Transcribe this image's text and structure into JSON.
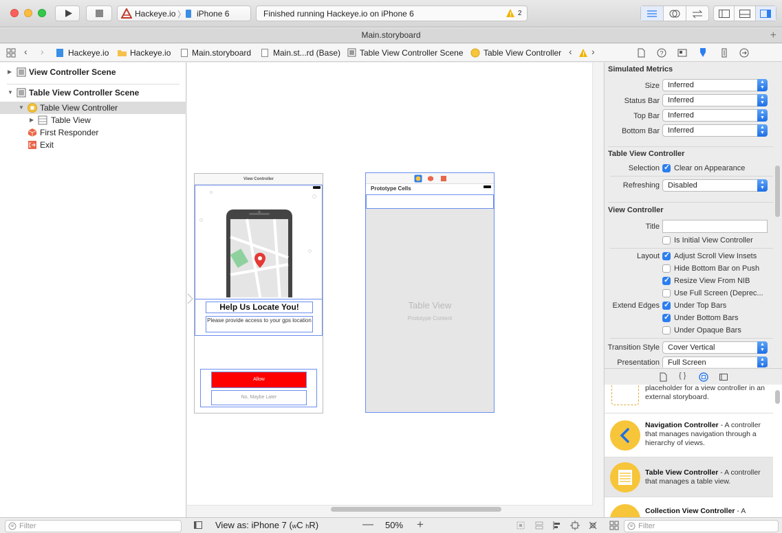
{
  "toolbar": {
    "scheme_name": "Hackeye.io",
    "device": "iPhone 6",
    "status_text": "Finished running Hackeye.io on iPhone 6",
    "warning_count": "2"
  },
  "tab": {
    "title": "Main.storyboard"
  },
  "jumpbar": {
    "items": [
      "Hackeye.io",
      "Hackeye.io",
      "Main.storyboard",
      "Main.st...rd (Base)",
      "Table View Controller Scene",
      "Table View Controller"
    ]
  },
  "outline": {
    "scene1": "View Controller Scene",
    "scene2": "Table View Controller Scene",
    "controller": "Table View Controller",
    "table_view": "Table View",
    "first_responder": "First Responder",
    "exit": "Exit",
    "filter_placeholder": "Filter"
  },
  "canvas": {
    "vc_title": "View Controller",
    "help_title": "Help Us Locate You!",
    "help_text": "Please provide access to your gps location",
    "allow_label": "Allow",
    "later_label": "No, Maybe Later",
    "prototype_cells": "Prototype Cells",
    "table_view_label": "Table View",
    "prototype_content": "Prototype Content"
  },
  "inspector": {
    "simulated_metrics": {
      "header": "Simulated Metrics",
      "size_label": "Size",
      "size_value": "Inferred",
      "status_bar_label": "Status Bar",
      "status_bar_value": "Inferred",
      "top_bar_label": "Top Bar",
      "top_bar_value": "Inferred",
      "bottom_bar_label": "Bottom Bar",
      "bottom_bar_value": "Inferred"
    },
    "table_view_controller": {
      "header": "Table View Controller",
      "selection_label": "Selection",
      "clear_on_appearance": "Clear on Appearance",
      "refreshing_label": "Refreshing",
      "refreshing_value": "Disabled"
    },
    "view_controller": {
      "header": "View Controller",
      "title_label": "Title",
      "is_initial": "Is Initial View Controller",
      "layout_label": "Layout",
      "adjust_scroll": "Adjust Scroll View Insets",
      "hide_bottom": "Hide Bottom Bar on Push",
      "resize_nib": "Resize View From NIB",
      "full_screen": "Use Full Screen (Deprec...",
      "extend_edges_label": "Extend Edges",
      "under_top": "Under Top Bars",
      "under_bottom": "Under Bottom Bars",
      "under_opaque": "Under Opaque Bars",
      "transition_label": "Transition Style",
      "transition_value": "Cover Vertical",
      "presentation_label": "Presentation",
      "presentation_value": "Full Screen"
    }
  },
  "library": {
    "item0_text": "placeholder for a view controller in an external storyboard.",
    "item1_title": "Navigation Controller",
    "item1_text": " - A controller that manages navigation through a hierarchy of views.",
    "item2_title": "Table View Controller",
    "item2_text": " - A controller that manages a table view.",
    "item3_title": "Collection View Controller",
    "item3_text": " - A",
    "filter_placeholder": "Filter"
  },
  "bottombar": {
    "view_as": "View as: iPhone 7 (",
    "size_class_w": "w",
    "size_class_c": "C",
    "size_class_h": "h",
    "size_class_r": "R",
    "view_as_end": ")",
    "zoom": "50%"
  },
  "colors": {
    "accent": "#2c7ef0",
    "allow_button": "#ff0000",
    "warning": "#f0b400"
  }
}
